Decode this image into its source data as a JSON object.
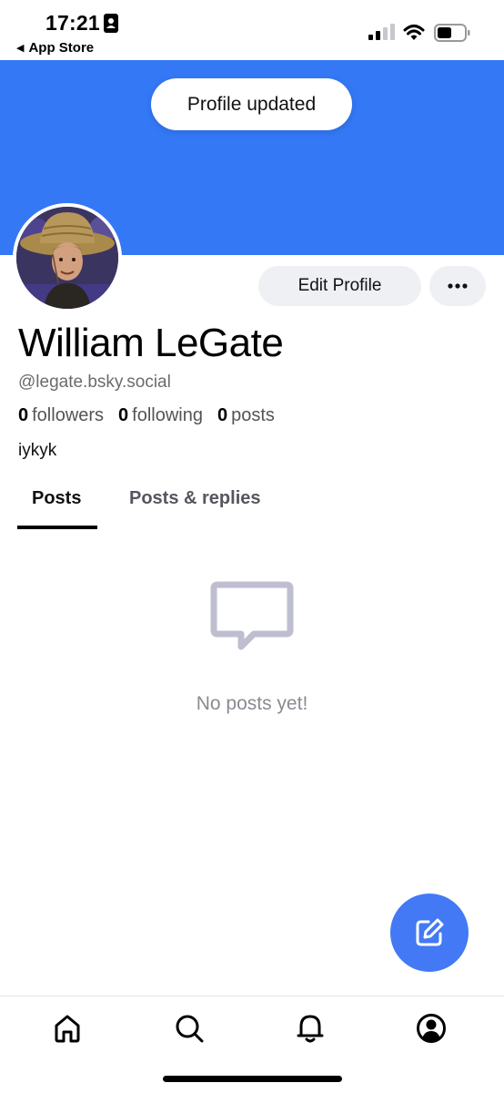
{
  "status_bar": {
    "time": "17:21",
    "back_label": "App Store",
    "back_icon": "back-triangle-icon",
    "id_icon": "contact-card-icon",
    "signal_icon": "cellular-signal-icon",
    "wifi_icon": "wifi-icon",
    "battery_icon": "battery-icon"
  },
  "toast": {
    "message": "Profile updated"
  },
  "profile": {
    "display_name": "William LeGate",
    "handle": "@legate.bsky.social",
    "bio": "iykyk",
    "stats": {
      "followers_count": "0",
      "followers_label": "followers",
      "following_count": "0",
      "following_label": "following",
      "posts_count": "0",
      "posts_label": "posts"
    },
    "edit_button_label": "Edit Profile",
    "more_icon": "ellipsis-icon"
  },
  "tabs": [
    {
      "label": "Posts",
      "active": true
    },
    {
      "label": "Posts & replies",
      "active": false
    }
  ],
  "empty_state": {
    "icon": "message-bubble-icon",
    "text": "No posts yet!"
  },
  "fab": {
    "icon": "compose-icon"
  },
  "bottom_nav": [
    {
      "icon": "home-icon"
    },
    {
      "icon": "search-icon"
    },
    {
      "icon": "bell-icon"
    },
    {
      "icon": "profile-icon"
    }
  ],
  "colors": {
    "banner": "#3478f6",
    "fab": "#4379f4",
    "button_bg": "#eff0f4",
    "muted_text": "#8a8a92"
  }
}
